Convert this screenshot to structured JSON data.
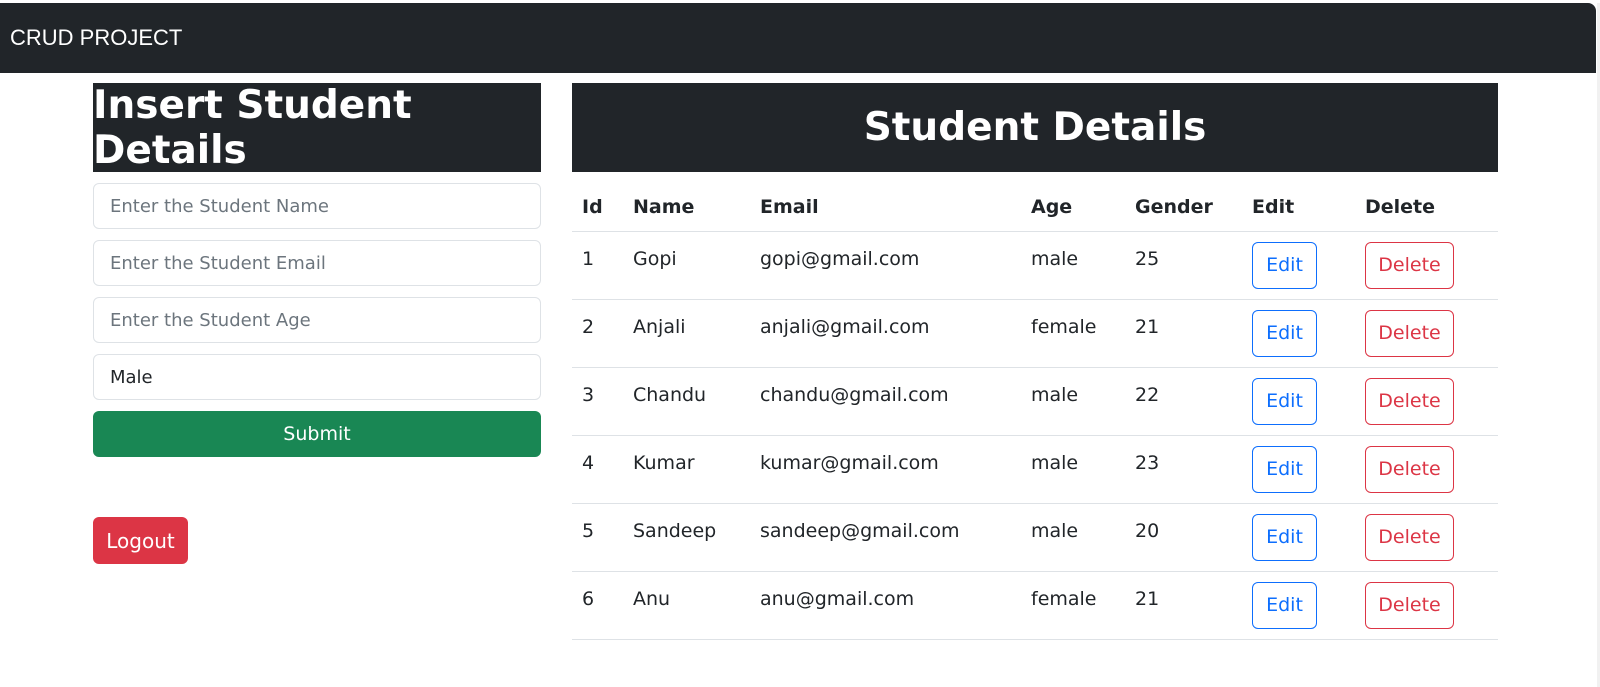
{
  "navbar": {
    "brand": "CRUD PROJECT"
  },
  "form": {
    "title": "Insert Student Details",
    "name_placeholder": "Enter the Student Name",
    "email_placeholder": "Enter the Student Email",
    "age_placeholder": "Enter the Student Age",
    "gender_value": "Male",
    "submit_label": "Submit"
  },
  "logout_label": "Logout",
  "table": {
    "title": "Student Details",
    "columns": [
      "Id",
      "Name",
      "Email",
      "Age",
      "Gender",
      "Edit",
      "Delete"
    ],
    "rows": [
      {
        "id": "1",
        "name": "Gopi",
        "email": "gopi@gmail.com",
        "age": "male",
        "gender": "25",
        "edit": "Edit",
        "delete": "Delete"
      },
      {
        "id": "2",
        "name": "Anjali",
        "email": "anjali@gmail.com",
        "age": "female",
        "gender": "21",
        "edit": "Edit",
        "delete": "Delete"
      },
      {
        "id": "3",
        "name": "Chandu",
        "email": "chandu@gmail.com",
        "age": "male",
        "gender": "22",
        "edit": "Edit",
        "delete": "Delete"
      },
      {
        "id": "4",
        "name": "Kumar",
        "email": "kumar@gmail.com",
        "age": "male",
        "gender": "23",
        "edit": "Edit",
        "delete": "Delete"
      },
      {
        "id": "5",
        "name": "Sandeep",
        "email": "sandeep@gmail.com",
        "age": "male",
        "gender": "20",
        "edit": "Edit",
        "delete": "Delete"
      },
      {
        "id": "6",
        "name": "Anu",
        "email": "anu@gmail.com",
        "age": "female",
        "gender": "21",
        "edit": "Edit",
        "delete": "Delete"
      }
    ]
  },
  "colors": {
    "dark": "#212529",
    "success": "#198754",
    "danger": "#dc3545",
    "primary": "#0d6efd"
  }
}
